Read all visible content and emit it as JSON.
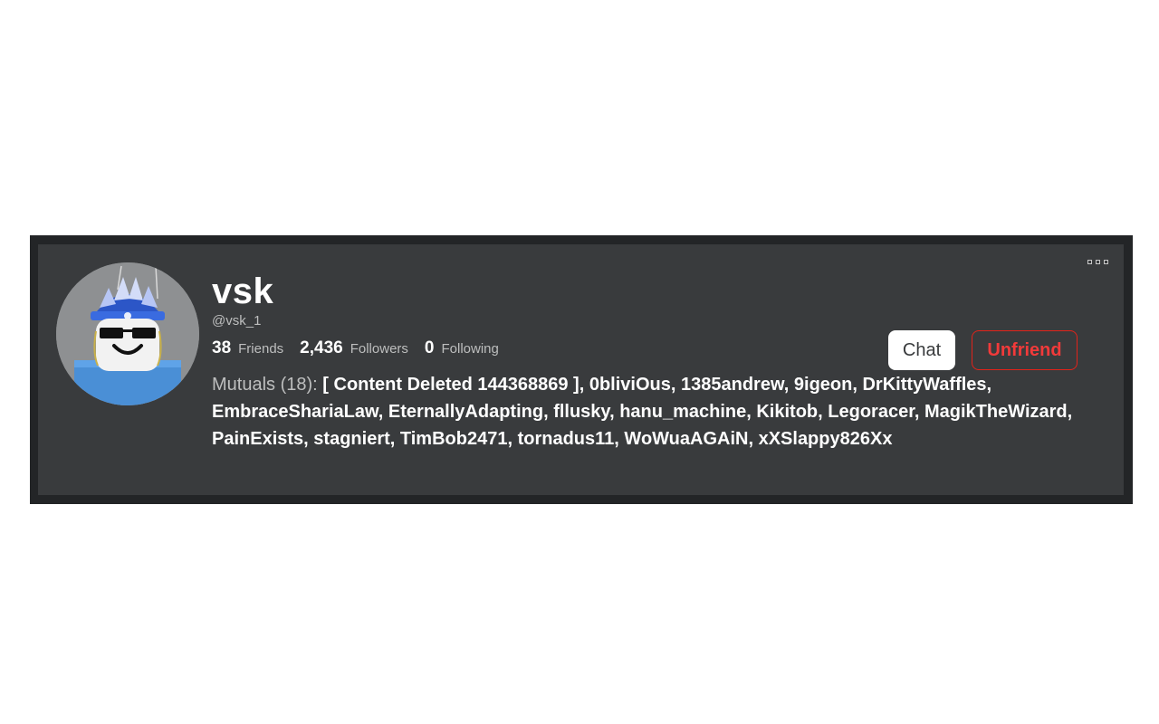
{
  "profile": {
    "display_name": "vsk",
    "username": "@vsk_1",
    "avatar_icon": "roblox-avatar-icon"
  },
  "stats": {
    "friends_count": "38",
    "friends_label": "Friends",
    "followers_count": "2,436",
    "followers_label": "Followers",
    "following_count": "0",
    "following_label": "Following"
  },
  "mutuals": {
    "label": "Mutuals (18):",
    "names": [
      "[ Content Deleted 144368869 ]",
      "0bliviOus",
      "1385andrew",
      "9igeon",
      "DrKittyWaffles",
      "EmbraceShariaLaw",
      "EternallyAdapting",
      "fllusky",
      "hanu_machine",
      "Kikitob",
      "Legoracer",
      "MagikTheWizard",
      "PainExists",
      "stagniert",
      "TimBob2471",
      "tornadus11",
      "WoWuaAGAiN",
      "xXSlappy826Xx"
    ]
  },
  "actions": {
    "chat_label": "Chat",
    "unfriend_label": "Unfriend"
  },
  "menu": {
    "icon": "more-options-icon"
  },
  "colors": {
    "frame": "#232527",
    "card": "#393b3d",
    "unfriend_red": "#e2231a",
    "secondary_text": "#bdbebe"
  }
}
